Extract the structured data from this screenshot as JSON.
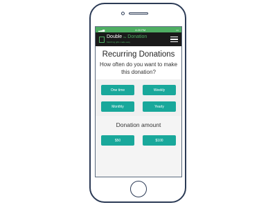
{
  "status": {
    "time": "4:20 PM",
    "signal": "▂▃▅",
    "battery": "▭"
  },
  "header": {
    "logo_part1": "Double",
    "logo_separator": "the",
    "logo_part2": "Donation",
    "tagline": "Matching gifts made easy",
    "menu_icon": "hamburger-menu-icon"
  },
  "page": {
    "title": "Recurring Donations",
    "question": "How often do you want to make this donation?",
    "frequency_options": [
      "One time",
      "Weekly",
      "Monthly",
      "Yearly"
    ],
    "amount_title": "Donation amount",
    "amount_options": [
      "$50",
      "$100"
    ]
  },
  "colors": {
    "accent": "#19a89b",
    "status_bar": "#4fae63",
    "header_bg": "#1a1a1a"
  }
}
